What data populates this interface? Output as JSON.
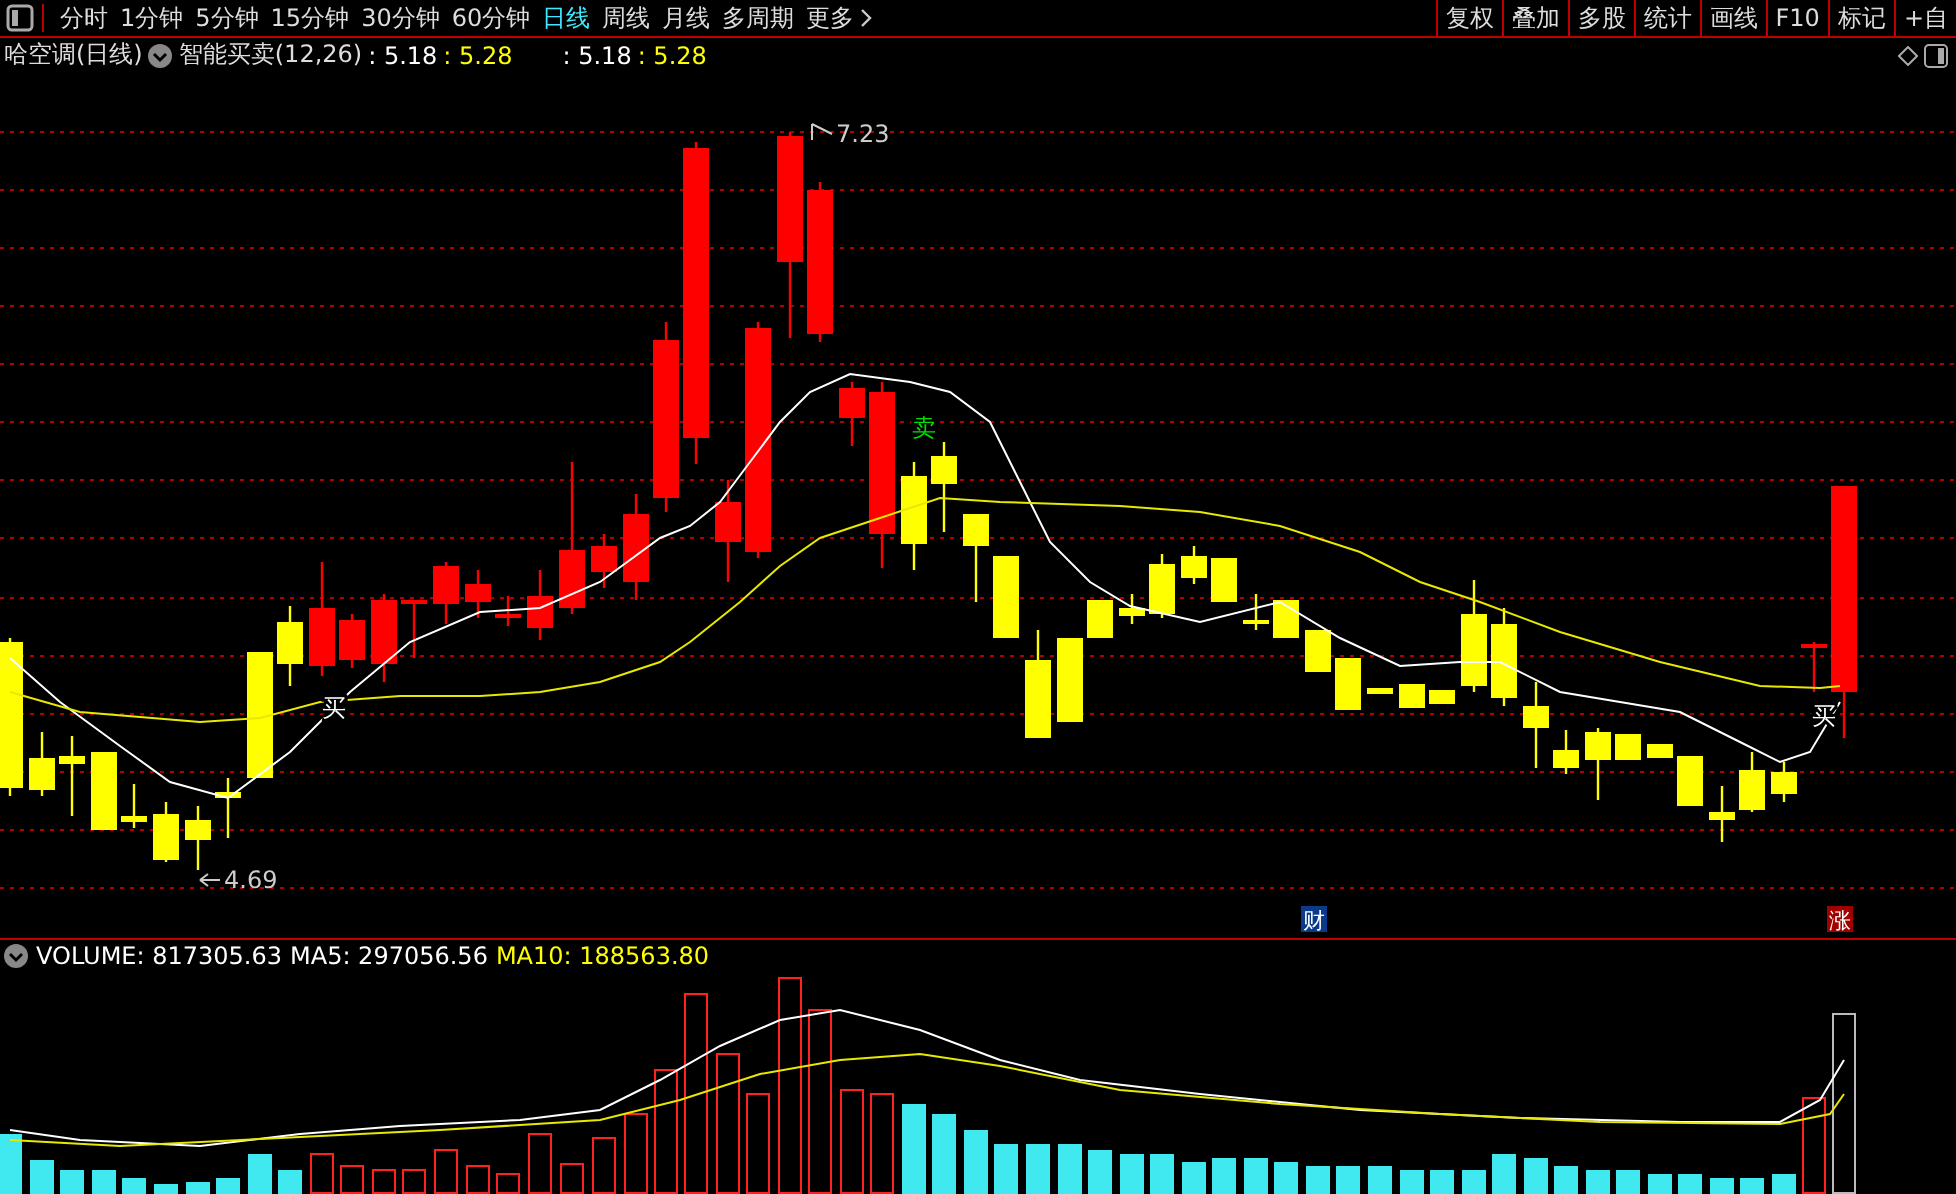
{
  "toolbar": {
    "periods": [
      {
        "label": "分时",
        "selected": false
      },
      {
        "label": "1分钟",
        "selected": false
      },
      {
        "label": "5分钟",
        "selected": false
      },
      {
        "label": "15分钟",
        "selected": false
      },
      {
        "label": "30分钟",
        "selected": false
      },
      {
        "label": "60分钟",
        "selected": false
      },
      {
        "label": "日线",
        "selected": true
      },
      {
        "label": "周线",
        "selected": false
      },
      {
        "label": "月线",
        "selected": false
      },
      {
        "label": "多周期",
        "selected": false
      }
    ],
    "more": "更多",
    "actions": [
      "复权",
      "叠加",
      "多股",
      "统计",
      "画线",
      "F10",
      "标记",
      "+自"
    ]
  },
  "indicator_bar": {
    "title": "哈空调(日线)",
    "indicator": "智能买卖(12,26)",
    "values": [
      {
        "text": ": 5.18",
        "color": "#ffffff"
      },
      {
        "text": ": 5.28",
        "color": "#ffff00"
      },
      {
        "text": ": 5.18",
        "color": "#ffffff"
      },
      {
        "text": ": 5.28",
        "color": "#ffff00"
      }
    ]
  },
  "price_chart": {
    "high_label": "7.23",
    "low_label": "4.69",
    "signals": [
      {
        "text": "买",
        "kind": "buy"
      },
      {
        "text": "卖",
        "kind": "sell"
      },
      {
        "text": "买",
        "kind": "buy"
      }
    ],
    "badges": [
      {
        "text": "财",
        "kind": "finance"
      },
      {
        "text": "涨",
        "kind": "rise"
      }
    ]
  },
  "volume": {
    "items": [
      {
        "label": "VOLUME: 817305.63",
        "color": "#ffffff"
      },
      {
        "label": "MA5: 297056.56",
        "color": "#ffffff"
      },
      {
        "label": "MA10: 188563.80",
        "color": "#ffff00"
      }
    ]
  }
}
